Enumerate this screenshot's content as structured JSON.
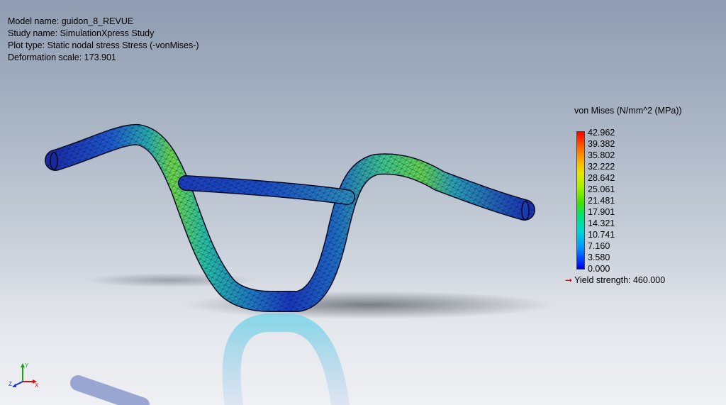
{
  "info": {
    "model_name": "Model name: guidon_8_REVUE",
    "study_name": "Study name: SimulationXpress Study",
    "plot_type": "Plot type: Static nodal stress Stress (-vonMises-)",
    "deformation_scale": "Deformation scale: 173.901"
  },
  "legend": {
    "title": "von Mises (N/mm^2 (MPa))",
    "ticks": [
      "42.962",
      "39.382",
      "35.802",
      "32.222",
      "28.642",
      "25.061",
      "21.481",
      "17.901",
      "14.321",
      "10.741",
      "7.160",
      "3.580",
      "0.000"
    ],
    "yield_label": "Yield strength: 460.000",
    "yield_marker_color": "#d00000"
  },
  "colors": {
    "max_stress": "#ff0000",
    "min_stress": "#0000e8",
    "mesh": "#0a0a20"
  },
  "triad": {
    "x_label": "X",
    "y_label": "Y",
    "z_label": "Z"
  }
}
